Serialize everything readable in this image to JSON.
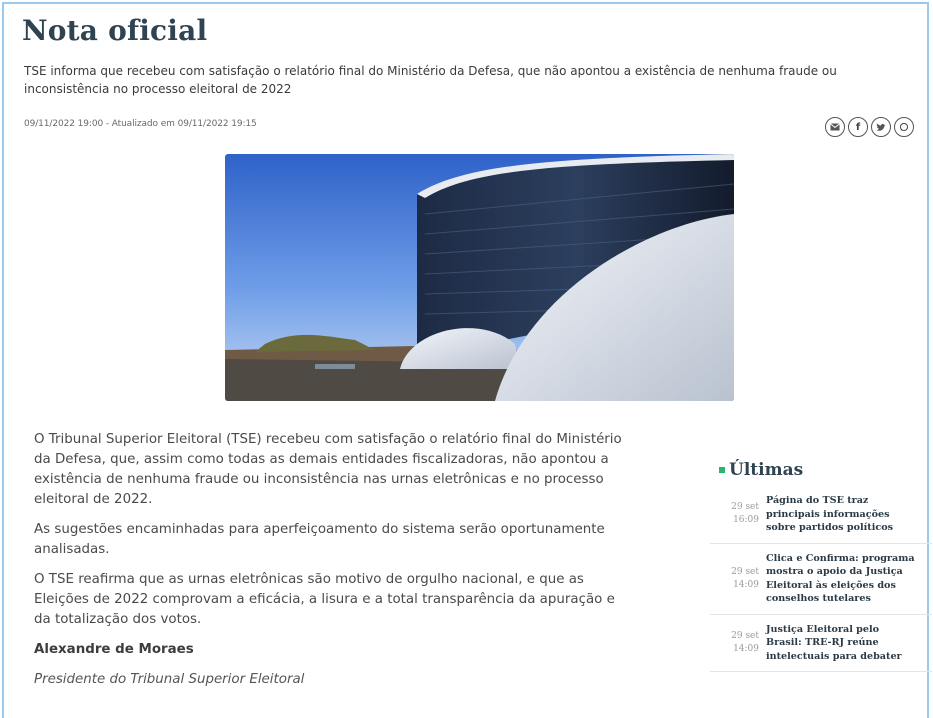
{
  "article": {
    "title": "Nota oficial",
    "subtitle": "TSE informa que recebeu com satisfação o relatório final do Ministério da Defesa, que não apontou a existência de nenhuma fraude ou inconsistência no processo eleitoral de 2022",
    "dates": "09/11/2022 19:00 - Atualizado em 09/11/2022 19:15",
    "paragraphs": [
      "O Tribunal Superior Eleitoral (TSE) recebeu com satisfação o relatório final do Ministério da Defesa, que, assim como todas as demais entidades fiscalizadoras, não apontou a existência de nenhuma fraude ou inconsistência nas urnas eletrônicas e no processo eleitoral de 2022.",
      "As sugestões encaminhadas para aperfeiçoamento do sistema serão oportunamente analisadas.",
      "O TSE reafirma que as urnas eletrônicas são motivo de orgulho nacional, e que as Eleições de 2022 comprovam a eficácia, a lisura e a total transparência da apuração e da totalização dos votos."
    ],
    "signature_name": "Alexandre de Moraes",
    "signature_role": "Presidente do Tribunal Superior Eleitoral"
  },
  "share": {
    "icons": [
      "envelope-icon",
      "facebook-icon",
      "twitter-icon",
      "whatsapp-icon"
    ]
  },
  "sidebar": {
    "title": "Últimas",
    "accent_color": "#2bb573",
    "items": [
      {
        "day": "29 set",
        "time": "16:09",
        "title": "Página do TSE traz principais informações sobre partidos políticos"
      },
      {
        "day": "29 set",
        "time": "14:09",
        "title": "Clica e Confirma: programa mostra o apoio da Justiça Eleitoral às eleições dos conselhos tutelares"
      },
      {
        "day": "29 set",
        "time": "14:09",
        "title": "Justiça Eleitoral pelo Brasil: TRE-RJ reúne intelectuais para debater"
      }
    ]
  }
}
